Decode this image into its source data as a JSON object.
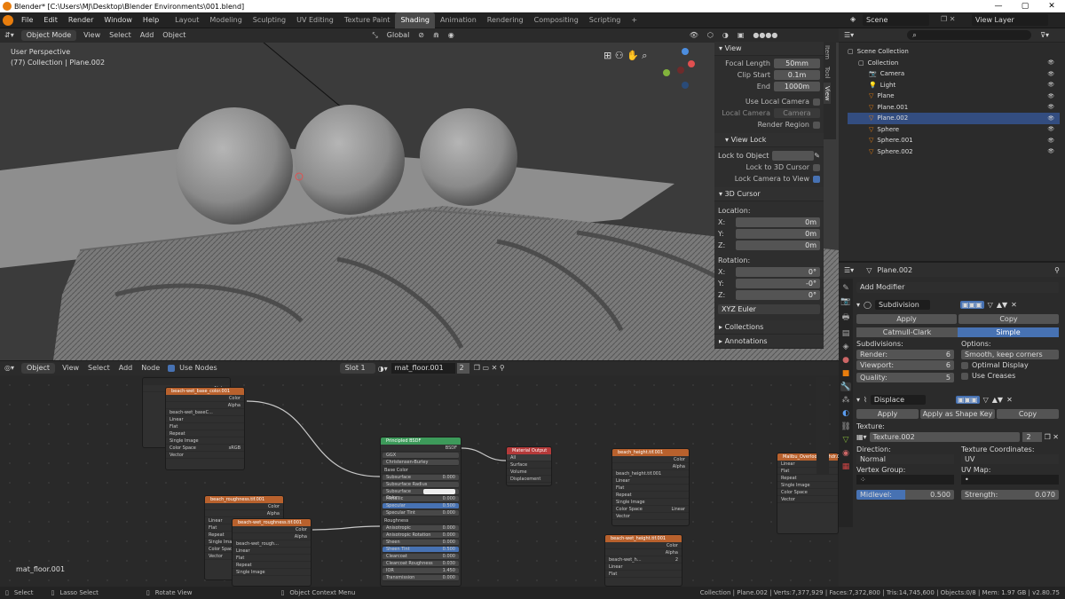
{
  "window": {
    "title": "Blender* [C:\\Users\\MJ\\Desktop\\Blender Environments\\001.blend]",
    "minimize": "—",
    "maximize": "▢",
    "close": "✕"
  },
  "menu": [
    "File",
    "Edit",
    "Render",
    "Window",
    "Help"
  ],
  "workspaces": [
    "Layout",
    "Modeling",
    "Sculpting",
    "UV Editing",
    "Texture Paint",
    "Shading",
    "Animation",
    "Rendering",
    "Compositing",
    "Scripting"
  ],
  "active_workspace": "Shading",
  "scene": {
    "name": "Scene",
    "view_layer": "View Layer"
  },
  "viewport": {
    "mode": "Object Mode",
    "menus": [
      "View",
      "Select",
      "Add",
      "Object"
    ],
    "orientation": "Global",
    "overlay_text1": "User Perspective",
    "overlay_text2": "(77) Collection | Plane.002"
  },
  "npanel": {
    "tabs": [
      "Item",
      "Tool",
      "View"
    ],
    "view_title": "View",
    "focal_label": "Focal Length",
    "focal": "50mm",
    "clip_start_label": "Clip Start",
    "clip_start": "0.1m",
    "end_label": "End",
    "end": "1000m",
    "use_local_camera": "Use Local Camera",
    "local_camera_label": "Local Camera",
    "local_camera": "Camera",
    "render_region": "Render Region",
    "view_lock_title": "View Lock",
    "lock_to_object": "Lock to Object",
    "lock_to_cursor": "Lock to 3D Cursor",
    "lock_camera": "Lock Camera to View",
    "cursor_title": "3D Cursor",
    "location_label": "Location:",
    "x": "X:",
    "y": "Y:",
    "z": "Z:",
    "loc_x": "0m",
    "loc_y": "0m",
    "loc_z": "0m",
    "rotation_label": "Rotation:",
    "rot_x": "0°",
    "rot_y": "-0°",
    "rot_z": "0°",
    "rotation_mode": "XYZ Euler",
    "collections": "Collections",
    "annotations": "Annotations"
  },
  "outliner": {
    "root": "Scene Collection",
    "items": [
      {
        "name": "Collection",
        "indent": 1
      },
      {
        "name": "Camera",
        "indent": 2
      },
      {
        "name": "Light",
        "indent": 2
      },
      {
        "name": "Plane",
        "indent": 2
      },
      {
        "name": "Plane.001",
        "indent": 2
      },
      {
        "name": "Plane.002",
        "indent": 2
      },
      {
        "name": "Sphere",
        "indent": 2
      },
      {
        "name": "Sphere.001",
        "indent": 2
      },
      {
        "name": "Sphere.002",
        "indent": 2
      }
    ]
  },
  "properties": {
    "object": "Plane.002",
    "add_modifier": "Add Modifier",
    "subdivision": {
      "name": "Subdivision",
      "apply": "Apply",
      "copy": "Copy",
      "catmull": "Catmull-Clark",
      "simple": "Simple",
      "subdivisions_label": "Subdivisions:",
      "render_label": "Render:",
      "render": "6",
      "viewport_label": "Viewport:",
      "viewport": "6",
      "quality_label": "Quality:",
      "quality": "5",
      "options_label": "Options:",
      "smooth": "Smooth, keep corners",
      "optimal": "Optimal Display",
      "creases": "Use Creases"
    },
    "displace": {
      "name": "Displace",
      "apply": "Apply",
      "apply_shape": "Apply as Shape Key",
      "copy": "Copy",
      "texture_label": "Texture:",
      "texture": "Texture.002",
      "users": "2",
      "direction_label": "Direction:",
      "direction": "Normal",
      "texcoords_label": "Texture Coordinates:",
      "texcoords": "UV",
      "vgroup_label": "Vertex Group:",
      "uvmap_label": "UV Map:",
      "midlevel_label": "Midlevel:",
      "midlevel": "0.500",
      "strength_label": "Strength:",
      "strength": "0.070"
    }
  },
  "node_editor": {
    "mode": "Object",
    "menus": [
      "View",
      "Select",
      "Add",
      "Node"
    ],
    "use_nodes": "Use Nodes",
    "slot": "Slot 1",
    "material": "mat_floor.001",
    "users": "2",
    "material_label": "mat_floor.001",
    "nodes": {
      "bsdf": "Principled BSDF",
      "bsdf_out": "BSDF",
      "ggx": "GGX",
      "burley": "Christensen-Burley",
      "base_color": "Base Color",
      "subsurface": "Subsurface",
      "subsurface_radius": "Subsurface Radius",
      "subsurface_color": "Subsurface Color",
      "metallic": "Metallic",
      "specular": "Specular",
      "specular_tint": "Specular Tint",
      "roughness": "Roughness",
      "anisotropic": "Anisotropic",
      "aniso_rot": "Anisotropic Rotation",
      "sheen": "Sheen",
      "sheen_tint": "Sheen Tint",
      "clearcoat": "Clearcoat",
      "cc_rough": "Clearcoat Roughness",
      "ior": "IOR",
      "transmission": "Transmission",
      "v_sub": "0.000",
      "v_metal": "0.000",
      "v_spec": "0.500",
      "v_spectint": "0.000",
      "v_aniso": "0.000",
      "v_anisorot": "0.000",
      "v_sheen": "0.000",
      "v_sheentint": "0.500",
      "v_cc": "0.000",
      "v_ccr": "0.030",
      "v_ior": "1.450",
      "v_trans": "0.000",
      "output": "Material Output",
      "all": "All",
      "surface": "Surface",
      "volume": "Volume",
      "displacement": "Displacement",
      "color": "Color",
      "alpha": "Alpha",
      "linear": "Linear",
      "flat": "Flat",
      "repeat": "Repeat",
      "single_image": "Single Image",
      "color_space": "Color Space",
      "srgb": "sRGB",
      "vector": "Vector",
      "n_base": "beach-wet_base_color.001",
      "n_base_img": "beach-wet_baseC...",
      "n_rough": "beach_roughness.tif.001",
      "n_rough2": "beach-wet_roughness.tif.001",
      "n_rough_img": "beach-wet_rough...",
      "n_h1": "beach_height.tif.001",
      "n_h1_img": "beach_height.tif.001",
      "n_h2": "beach-wet_height.tif.001",
      "n_h2_img": "beach-wet_h...",
      "n_malibu": "Malibu_Overlook_3k.hdr.001",
      "two": "2",
      "single_imag": "Single Imag",
      "color_spac": "Color Spac",
      "vect": "Vect"
    }
  },
  "status": {
    "select": "Select",
    "lasso": "Lasso Select",
    "rotate": "Rotate View",
    "context": "Object Context Menu",
    "stats": "Collection | Plane.002 | Verts:7,377,929 | Faces:7,372,800 | Tris:14,745,600 | Objects:0/8 | Mem: 1.97 GB | v2.80.75"
  }
}
